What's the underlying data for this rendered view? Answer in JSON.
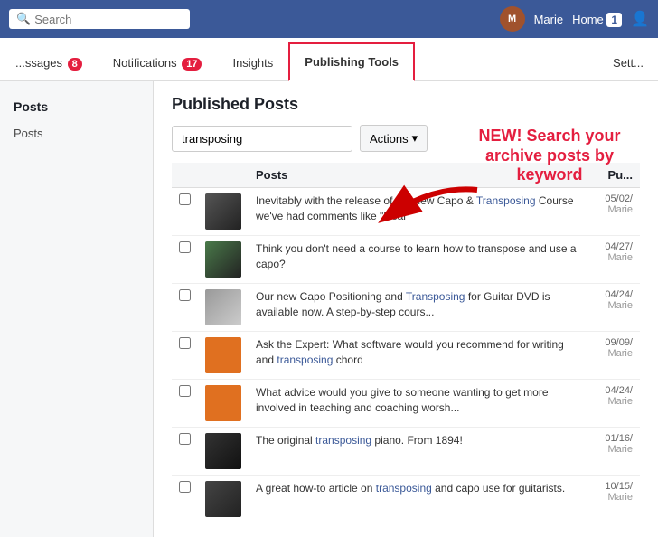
{
  "topbar": {
    "search_placeholder": "Search",
    "user_name": "Marie",
    "home_label": "Home",
    "home_badge": "1",
    "avatar_initials": "M"
  },
  "page_nav": {
    "tabs": [
      {
        "id": "messages",
        "label": "ssages",
        "badge": "8",
        "active": false
      },
      {
        "id": "notifications",
        "label": "Notifications",
        "badge": "17",
        "active": false
      },
      {
        "id": "insights",
        "label": "Insights",
        "active": false
      },
      {
        "id": "publishing_tools",
        "label": "Publishing Tools",
        "active": true
      },
      {
        "id": "settings",
        "label": "Sett...",
        "active": false
      }
    ]
  },
  "sidebar": {
    "title": "Posts",
    "items": [
      {
        "label": "Posts"
      }
    ]
  },
  "content": {
    "title": "Published Posts",
    "search_value": "transposing",
    "actions_label": "Actions",
    "actions_chevron": "▾",
    "annotation": "NEW! Search your archive posts by keyword",
    "table": {
      "headers": [
        {
          "label": ""
        },
        {
          "label": ""
        },
        {
          "label": "Posts"
        },
        {
          "label": "Pu..."
        }
      ],
      "rows": [
        {
          "id": "row1",
          "date": "05/02/",
          "author": "Marie",
          "text_before": "Inevitably with the release of our new Capo & ",
          "link_text": "Transposing",
          "text_after": " Course we've had comments like \"Real",
          "thumb_class": "thumb-1"
        },
        {
          "id": "row2",
          "date": "04/27/",
          "author": "Marie",
          "text_before": "Think you don't need a course to learn how to transpose and use a capo?",
          "link_text": "",
          "text_after": "",
          "thumb_class": "thumb-2"
        },
        {
          "id": "row3",
          "date": "04/24/",
          "author": "Marie",
          "text_before": "Our new Capo Positioning and ",
          "link_text": "Transposing",
          "text_after": " for Guitar DVD is available now. A step-by-step cours...",
          "thumb_class": "thumb-3"
        },
        {
          "id": "row4",
          "date": "09/09/",
          "author": "Marie",
          "text_before": "Ask the Expert: What software would you recommend for writing and ",
          "link_text": "transposing",
          "text_after": " chord",
          "thumb_class": "thumb-4"
        },
        {
          "id": "row5",
          "date": "04/24/",
          "author": "Marie",
          "text_before": "What advice would you give to someone wanting to get more involved in teaching and coaching worsh...",
          "link_text": "",
          "text_after": "",
          "thumb_class": "thumb-4"
        },
        {
          "id": "row6",
          "date": "01/16/",
          "author": "Marie",
          "text_before": "The original ",
          "link_text": "transposing",
          "text_after": " piano. From 1894!",
          "thumb_class": "thumb-5"
        },
        {
          "id": "row7",
          "date": "10/15/",
          "author": "Marie",
          "text_before": "A great how-to article on ",
          "link_text": "transposing",
          "text_after": " and capo use for guitarists.",
          "thumb_class": "thumb-6"
        }
      ]
    }
  }
}
